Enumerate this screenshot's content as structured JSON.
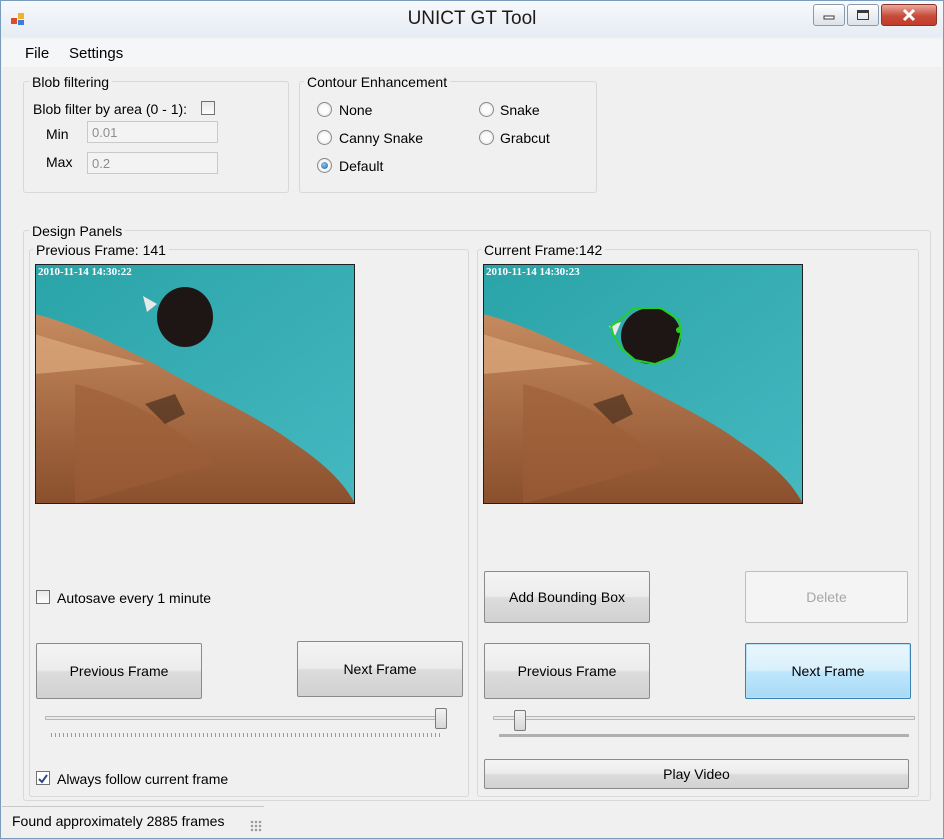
{
  "window": {
    "title": "UNICT GT Tool"
  },
  "menu": {
    "items": [
      "File",
      "Settings"
    ]
  },
  "blob_filtering": {
    "title": "Blob filtering",
    "filter_label": "Blob filter by area (0 - 1):",
    "filter_checked": false,
    "min_label": "Min",
    "min_value": "0.01",
    "max_label": "Max",
    "max_value": "0.2"
  },
  "contour": {
    "title": "Contour Enhancement",
    "options": [
      "None",
      "Snake",
      "Canny Snake",
      "Grabcut",
      "Default"
    ],
    "selected": "Default"
  },
  "design_panels": {
    "title": "Design Panels",
    "left": {
      "frame_label": "Previous Frame: 141",
      "timestamp": "2010-11-14 14:30:22",
      "autosave_label": "Autosave every 1 minute",
      "autosave_checked": false,
      "prev_button": "Previous Frame",
      "next_button": "Next Frame",
      "slider_value": 1.0,
      "follow_label": "Always follow current frame",
      "follow_checked": true
    },
    "right": {
      "frame_label": "Current Frame:142",
      "timestamp": "2010-11-14 14:30:23",
      "add_bbox_button": "Add Bounding Box",
      "delete_button": "Delete",
      "prev_button": "Previous Frame",
      "next_button": "Next Frame",
      "slider_value": 0.05,
      "play_button": "Play Video"
    }
  },
  "status": {
    "text": "Found approximately 2885 frames"
  },
  "colors": {
    "water": "#3aa6a6",
    "contour": "#22d022",
    "accent": "#3c7fb1"
  }
}
